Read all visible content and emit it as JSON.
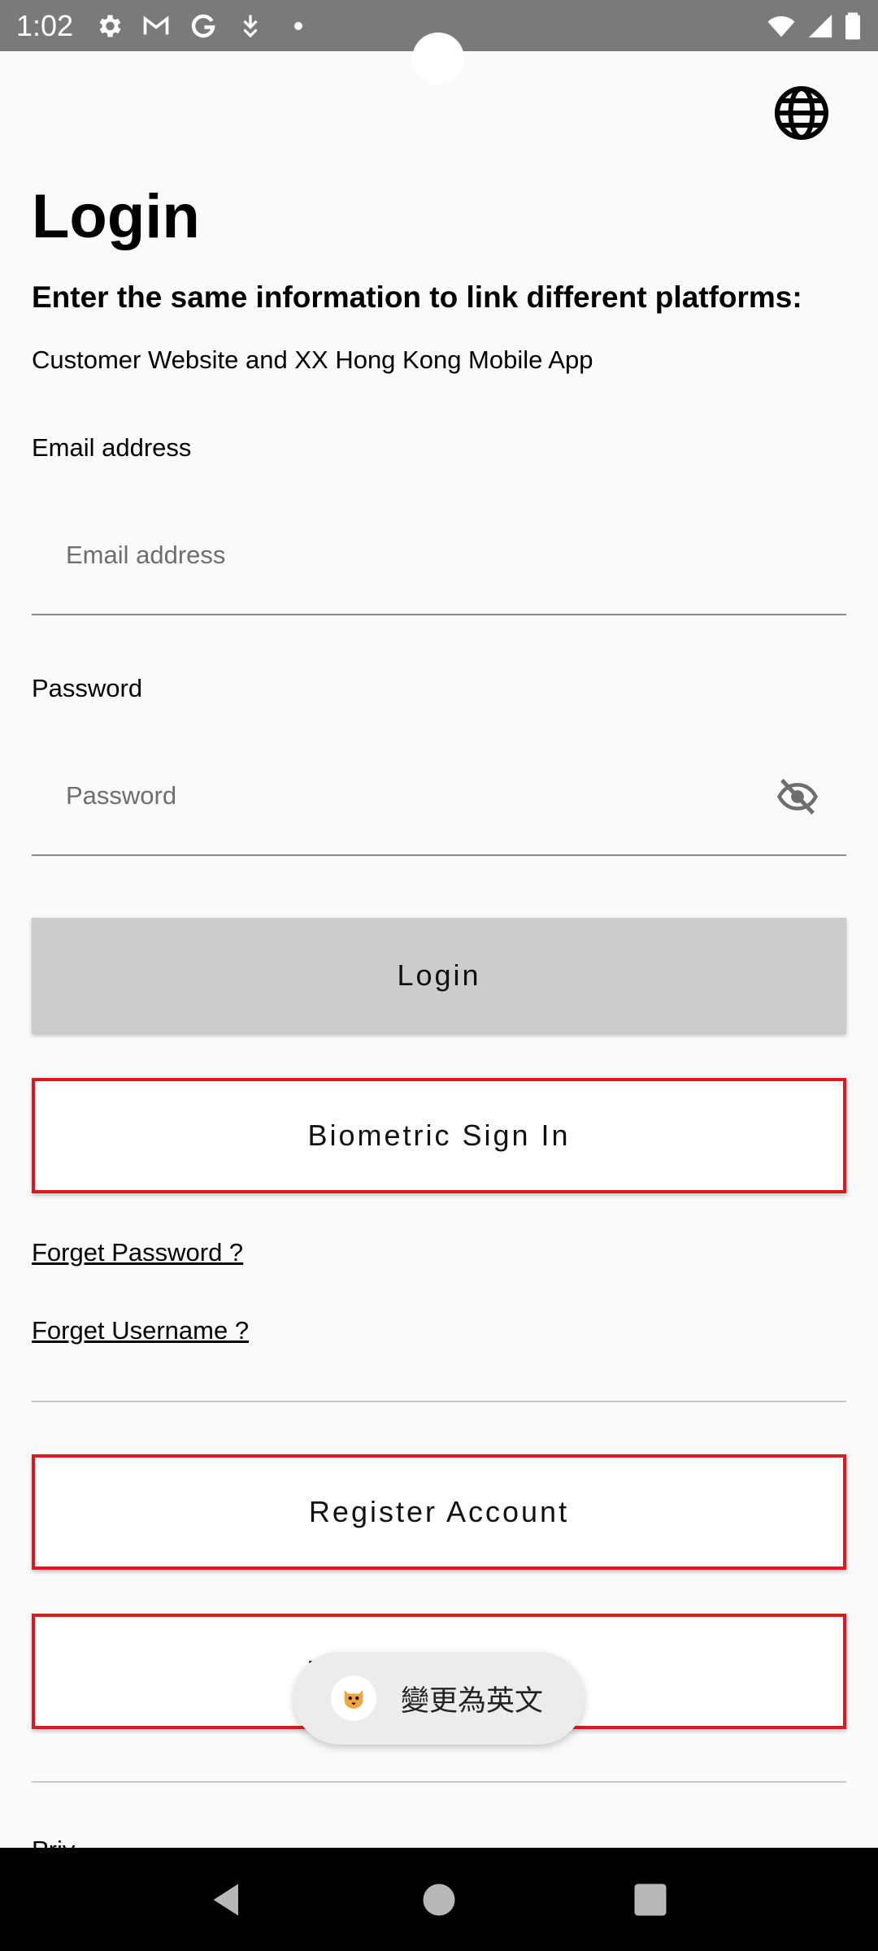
{
  "status_bar": {
    "time": "1:02",
    "left_icons": [
      "settings-icon",
      "gmail-icon",
      "google-icon",
      "download-icon",
      "dot-icon"
    ],
    "right_icons": [
      "wifi-icon",
      "signal-icon",
      "battery-icon"
    ]
  },
  "header": {
    "title": "Login",
    "subtitle": "Enter the same information to link different platforms:",
    "description": "Customer Website and XX Hong Kong Mobile App"
  },
  "form": {
    "email_label": "Email address",
    "email_placeholder": "Email address",
    "email_value": "",
    "password_label": "Password",
    "password_placeholder": "Password",
    "password_value": ""
  },
  "buttons": {
    "login": "Login",
    "biometric": "Biometric Sign In",
    "register": "Register Account",
    "user_register": "User S… …gister"
  },
  "links": {
    "forget_password": "Forget Password ?",
    "forget_username": "Forget Username ?"
  },
  "footer": {
    "cutoff_text": "Priv…"
  },
  "toast": {
    "text": "變更為英文",
    "icon": "tiger-icon"
  },
  "colors": {
    "accent_border": "#e8141b",
    "login_button_bg": "#cccccc",
    "status_bar_bg": "#7a7a7a"
  }
}
